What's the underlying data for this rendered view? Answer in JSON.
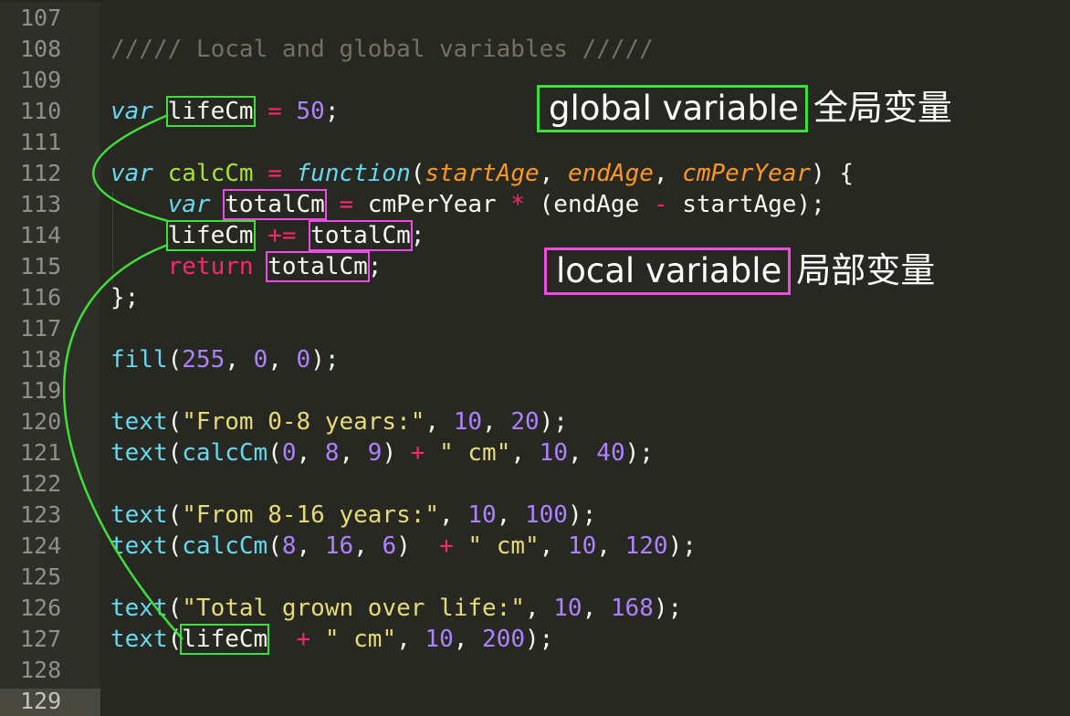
{
  "editor": {
    "theme_colors": {
      "background": "#272822",
      "gutter": "#2f2f2a",
      "comment": "#75715e",
      "keyword": "#f92672",
      "storage": "#66d9ef",
      "number": "#ae81ff",
      "string": "#e6db74",
      "function_name": "#a6e22e",
      "parameter": "#fd971f",
      "highlight_green": "#3ee03a",
      "highlight_magenta": "#ee4ce4"
    },
    "line_numbers": [
      "107",
      "108",
      "109",
      "110",
      "111",
      "112",
      "113",
      "114",
      "115",
      "116",
      "117",
      "118",
      "119",
      "120",
      "121",
      "122",
      "123",
      "124",
      "125",
      "126",
      "127",
      "128",
      "129"
    ],
    "active_line": "129"
  },
  "code": {
    "l108_comment": "///// Local and global variables /////",
    "l110_var": "var",
    "l110_name": "lifeCm",
    "l110_eq": " = ",
    "l110_val": "50",
    "l110_end": ";",
    "l112_var": "var",
    "l112_name": "calcCm",
    "l112_eq": " = ",
    "l112_function": "function",
    "l112_open": "(",
    "l112_p1": "startAge",
    "l112_c1": ", ",
    "l112_p2": "endAge",
    "l112_c2": ", ",
    "l112_p3": "cmPerYear",
    "l112_close": ") {",
    "l113_var": "var",
    "l113_name": "totalCm",
    "l113_eq": " = ",
    "l113_a": "cmPerYear ",
    "l113_mul": "*",
    "l113_b": " (endAge ",
    "l113_minus": "-",
    "l113_c": " startAge);",
    "l114_name": "lifeCm",
    "l114_op": " += ",
    "l114_val": "totalCm",
    "l114_end": ";",
    "l115_return": "return",
    "l115_val": "totalCm",
    "l115_end": ";",
    "l116": "};",
    "l118_fn": "fill",
    "l118_open": "(",
    "l118_n1": "255",
    "l118_c1": ", ",
    "l118_n2": "0",
    "l118_c2": ", ",
    "l118_n3": "0",
    "l118_close": ");",
    "l120_fn": "text",
    "l120_open": "(",
    "l120_str": "\"From 0-8 years:\"",
    "l120_c1": ", ",
    "l120_n1": "10",
    "l120_c2": ", ",
    "l120_n2": "20",
    "l120_close": ");",
    "l121_fn": "text",
    "l121_open": "(",
    "l121_call": "calcCm",
    "l121_open2": "(",
    "l121_n1": "0",
    "l121_c1": ", ",
    "l121_n2": "8",
    "l121_c2": ", ",
    "l121_n3": "9",
    "l121_close2": ") ",
    "l121_plus": "+",
    "l121_sp": " ",
    "l121_str": "\" cm\"",
    "l121_c3": ", ",
    "l121_n4": "10",
    "l121_c4": ", ",
    "l121_n5": "40",
    "l121_close": ");",
    "l123_fn": "text",
    "l123_open": "(",
    "l123_str": "\"From 8-16 years:\"",
    "l123_c1": ", ",
    "l123_n1": "10",
    "l123_c2": ", ",
    "l123_n2": "100",
    "l123_close": ");",
    "l124_fn": "text",
    "l124_open": "(",
    "l124_call": "calcCm",
    "l124_open2": "(",
    "l124_n1": "8",
    "l124_c1": ", ",
    "l124_n2": "16",
    "l124_c2": ", ",
    "l124_n3": "6",
    "l124_close2": ")  ",
    "l124_plus": "+",
    "l124_sp": " ",
    "l124_str": "\" cm\"",
    "l124_c3": ", ",
    "l124_n4": "10",
    "l124_c4": ", ",
    "l124_n5": "120",
    "l124_close": ");",
    "l126_fn": "text",
    "l126_open": "(",
    "l126_str": "\"Total grown over life:\"",
    "l126_c1": ", ",
    "l126_n1": "10",
    "l126_c2": ", ",
    "l126_n2": "168",
    "l126_close": ");",
    "l127_fn": "text",
    "l127_open": "(",
    "l127_name": "lifeCm",
    "l127_sp": "  ",
    "l127_plus": "+",
    "l127_sp2": " ",
    "l127_str": "\" cm\"",
    "l127_c1": ", ",
    "l127_n1": "10",
    "l127_c2": ", ",
    "l127_n2": "200",
    "l127_close": ");"
  },
  "annotations": {
    "global_label": "global variable",
    "global_cjk": "全局变量",
    "local_label": "local variable",
    "local_cjk": "局部变量"
  }
}
